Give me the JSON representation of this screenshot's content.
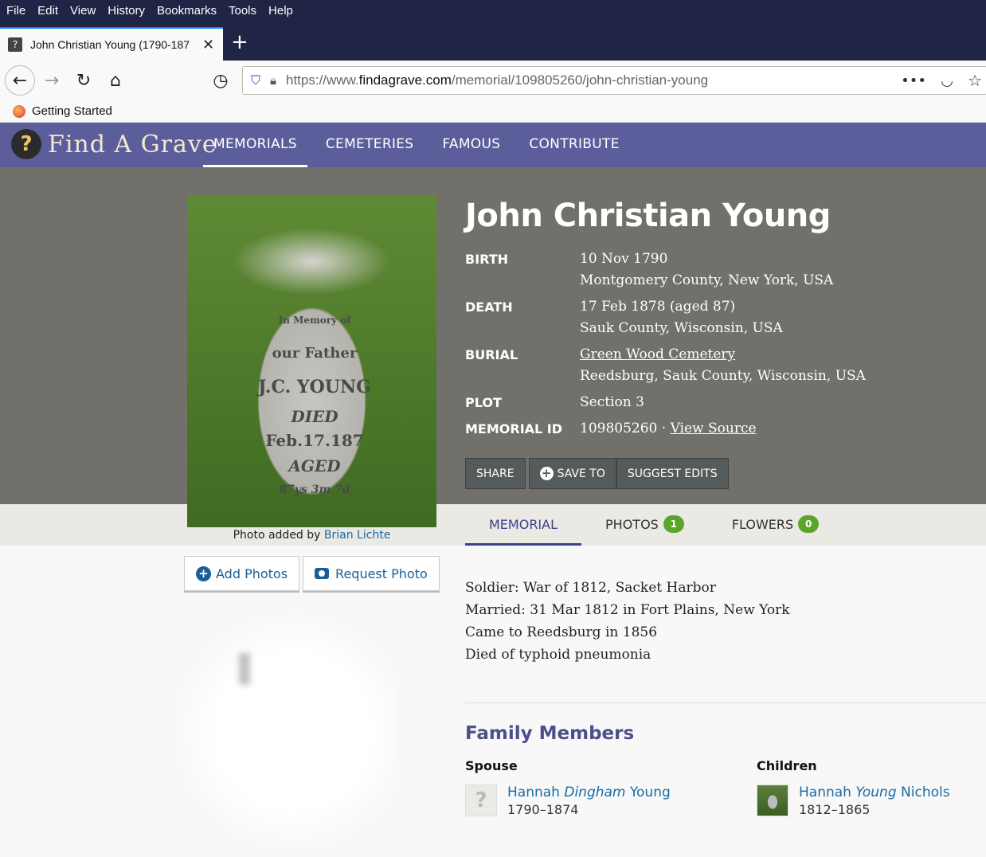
{
  "browser": {
    "menu": [
      "File",
      "Edit",
      "View",
      "History",
      "Bookmarks",
      "Tools",
      "Help"
    ],
    "tab_title": "John Christian Young (1790-187",
    "url_prefix": "https://www.",
    "url_domain": "findagrave.com",
    "url_path": "/memorial/109805260/john-christian-young",
    "bookmark": "Getting Started"
  },
  "site": {
    "logo_text": "Find A Grave",
    "nav": [
      "MEMORIALS",
      "CEMETERIES",
      "FAMOUS",
      "CONTRIBUTE"
    ]
  },
  "memorial": {
    "name": "John Christian Young",
    "photo_caption_prefix": "Photo added by",
    "photo_credit": "Brian Lichte",
    "headstone_lines": [
      "In Memory of",
      "our Father",
      "J.C. YOUNG",
      "DIED",
      "Feb.17.187",
      "AGED",
      "87ys 3m 7d"
    ],
    "facts": {
      "birth_label": "BIRTH",
      "birth_date": "10 Nov 1790",
      "birth_place": "Montgomery County, New York, USA",
      "death_label": "DEATH",
      "death_date": "17 Feb 1878 (aged 87)",
      "death_place": "Sauk County, Wisconsin, USA",
      "burial_label": "BURIAL",
      "burial_cemetery": "Green Wood Cemetery",
      "burial_place": "Reedsburg, Sauk County, Wisconsin, USA",
      "plot_label": "PLOT",
      "plot_value": "Section 3",
      "id_label": "MEMORIAL ID",
      "id_value": "109805260 · ",
      "view_source": "View Source"
    },
    "actions": {
      "share": "SHARE",
      "save_to": "SAVE TO",
      "suggest": "SUGGEST EDITS"
    },
    "tabs": {
      "memorial": "MEMORIAL",
      "photos": "PHOTOS",
      "photos_count": "1",
      "flowers": "FLOWERS",
      "flowers_count": "0"
    },
    "photo_buttons": {
      "add": "Add Photos",
      "request": "Request Photo"
    },
    "bio": [
      "Soldier: War of 1812, Sacket Harbor",
      "Married: 31 Mar 1812 in Fort Plains, New York",
      "Came to Reedsburg in 1856",
      "Died of typhoid pneumonia"
    ]
  },
  "family": {
    "title": "Family Members",
    "spouse_label": "Spouse",
    "spouse": {
      "first": "Hannah ",
      "maiden": "Dingham",
      "last": " Young",
      "years": "1790–1874"
    },
    "children_label": "Children",
    "child": {
      "first": "Hannah ",
      "maiden": "Young",
      "last": " Nichols",
      "years": "1812–1865"
    }
  }
}
